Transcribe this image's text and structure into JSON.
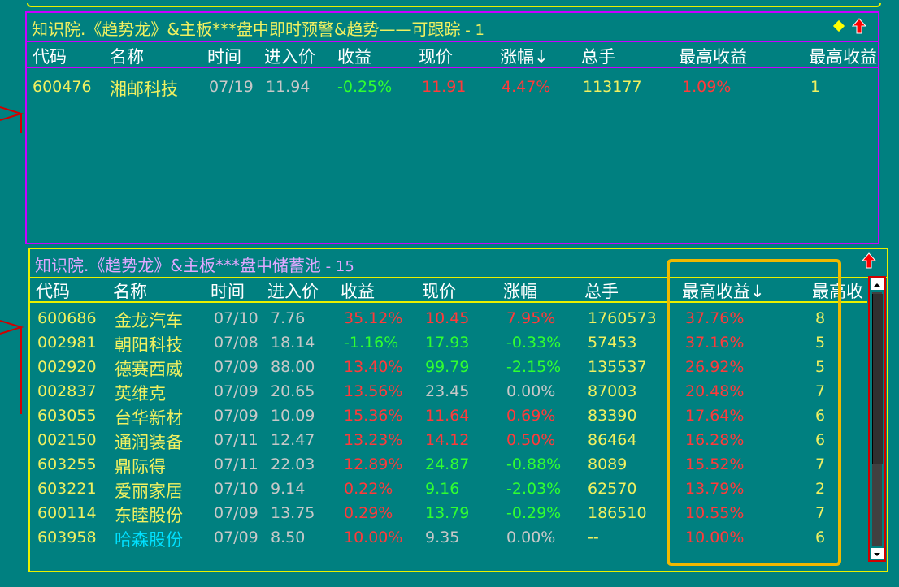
{
  "top_panel": {
    "title": "知识院.《趋势龙》&主板***盘中即时预警&趋势——可跟踪",
    "count": " - 1",
    "headers": [
      "代码",
      "名称",
      "时间",
      "进入价",
      "收益",
      "现价",
      "涨幅↓",
      "总手",
      "最高收益",
      "最高收益"
    ],
    "rows": [
      {
        "code": "600476",
        "name": "湘邮科技",
        "time": "07/19",
        "entry": "11.94",
        "gain": "-0.25%",
        "price": "11.91",
        "change": "4.47%",
        "volume": "113177",
        "max_gain": "1.09%",
        "days": "1"
      }
    ]
  },
  "bottom_panel": {
    "title": "知识院.《趋势龙》&主板***盘中储蓄池",
    "count": " - 15",
    "headers": [
      "代码",
      "名称",
      "时间",
      "进入价",
      "收益",
      "现价",
      "涨幅",
      "总手",
      "最高收益↓",
      "最高收"
    ],
    "rows": [
      {
        "code": "600686",
        "name": "金龙汽车",
        "time": "07/10",
        "entry": "7.76",
        "gain": "35.12%",
        "price": "10.45",
        "change": "7.95%",
        "volume": "1760573",
        "max_gain": "37.76%",
        "days": "8",
        "name_color": "yellow",
        "gain_color": "red",
        "price_color": "red",
        "change_color": "red"
      },
      {
        "code": "002981",
        "name": "朝阳科技",
        "time": "07/08",
        "entry": "18.14",
        "gain": "-1.16%",
        "price": "17.93",
        "change": "-0.33%",
        "volume": "57453",
        "max_gain": "37.16%",
        "days": "5",
        "name_color": "yellow",
        "gain_color": "green",
        "price_color": "green",
        "change_color": "green"
      },
      {
        "code": "002920",
        "name": "德赛西威",
        "time": "07/09",
        "entry": "88.00",
        "gain": "13.40%",
        "price": "99.79",
        "change": "-2.15%",
        "volume": "135537",
        "max_gain": "26.92%",
        "days": "5",
        "name_color": "yellow",
        "gain_color": "red",
        "price_color": "green",
        "change_color": "green"
      },
      {
        "code": "002837",
        "name": "英维克",
        "time": "07/09",
        "entry": "20.65",
        "gain": "13.56%",
        "price": "23.45",
        "change": "0.00%",
        "volume": "87003",
        "max_gain": "20.48%",
        "days": "7",
        "name_color": "yellow",
        "gain_color": "red",
        "price_color": "white",
        "change_color": "white"
      },
      {
        "code": "603055",
        "name": "台华新材",
        "time": "07/09",
        "entry": "10.09",
        "gain": "15.36%",
        "price": "11.64",
        "change": "0.69%",
        "volume": "83390",
        "max_gain": "17.64%",
        "days": "6",
        "name_color": "yellow",
        "gain_color": "red",
        "price_color": "red",
        "change_color": "red"
      },
      {
        "code": "002150",
        "name": "通润装备",
        "time": "07/11",
        "entry": "12.47",
        "gain": "13.23%",
        "price": "14.12",
        "change": "0.50%",
        "volume": "86464",
        "max_gain": "16.28%",
        "days": "6",
        "name_color": "yellow",
        "gain_color": "red",
        "price_color": "red",
        "change_color": "red"
      },
      {
        "code": "603255",
        "name": "鼎际得",
        "time": "07/11",
        "entry": "22.03",
        "gain": "12.89%",
        "price": "24.87",
        "change": "-0.88%",
        "volume": "8089",
        "max_gain": "15.52%",
        "days": "7",
        "name_color": "yellow",
        "gain_color": "red",
        "price_color": "green",
        "change_color": "green"
      },
      {
        "code": "603221",
        "name": "爱丽家居",
        "time": "07/10",
        "entry": "9.14",
        "gain": "0.22%",
        "price": "9.16",
        "change": "-2.03%",
        "volume": "62570",
        "max_gain": "13.79%",
        "days": "2",
        "name_color": "yellow",
        "gain_color": "red",
        "price_color": "green",
        "change_color": "green"
      },
      {
        "code": "600114",
        "name": "东睦股份",
        "time": "07/09",
        "entry": "13.75",
        "gain": "0.29%",
        "price": "13.79",
        "change": "-0.29%",
        "volume": "186510",
        "max_gain": "10.55%",
        "days": "7",
        "name_color": "yellow",
        "gain_color": "red",
        "price_color": "green",
        "change_color": "green"
      },
      {
        "code": "603958",
        "name": "哈森股份",
        "time": "07/09",
        "entry": "8.50",
        "gain": "10.00%",
        "price": "9.35",
        "change": "0.00%",
        "volume": "--",
        "max_gain": "10.00%",
        "days": "6",
        "name_color": "cyan",
        "gain_color": "red",
        "price_color": "white",
        "change_color": "white"
      }
    ]
  },
  "icons": {
    "top_diamond": "diamond-icon",
    "top_arrow": "red-up-arrow-icon",
    "bottom_arrow": "red-up-arrow-icon"
  },
  "colors": {
    "background": "#008080",
    "top_border": "#c800ff",
    "bottom_border": "#e8f000",
    "highlight": "#f0b800",
    "up": "#ff3a3a",
    "down": "#30ff30"
  }
}
